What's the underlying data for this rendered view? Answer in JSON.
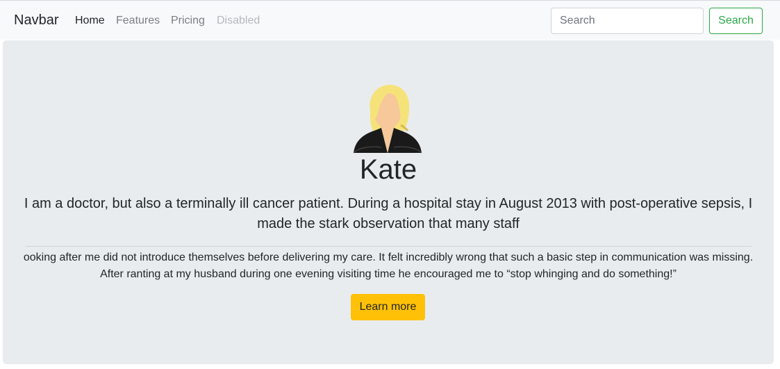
{
  "navbar": {
    "brand": "Navbar",
    "links": [
      {
        "label": "Home",
        "state": "active"
      },
      {
        "label": "Features",
        "state": "normal"
      },
      {
        "label": "Pricing",
        "state": "normal"
      },
      {
        "label": "Disabled",
        "state": "disabled"
      }
    ],
    "search": {
      "placeholder": "Search",
      "value": "",
      "button_label": "Search"
    }
  },
  "profile": {
    "avatar_icon": "woman-avatar-icon",
    "name": "Kate",
    "lead": "I am a doctor, but also a terminally ill cancer patient. During a hospital stay in August 2013 with post-operative sepsis, I made the stark observation that many staff",
    "body_line1": "ooking after me did not introduce themselves before delivering my care. It felt incredibly wrong that such a basic step in communication was missing.",
    "body_line2": "After ranting at my husband during one evening visiting time he encouraged me to “stop whinging and do something!”",
    "cta_label": "Learn more"
  },
  "colors": {
    "navbar_bg": "#f8f9fa",
    "jumbotron_bg": "#e9ecef",
    "success": "#28a745",
    "warning": "#ffc107",
    "hair": "#f5e37a",
    "skin": "#f6c89a",
    "jacket": "#1a1a1a"
  }
}
